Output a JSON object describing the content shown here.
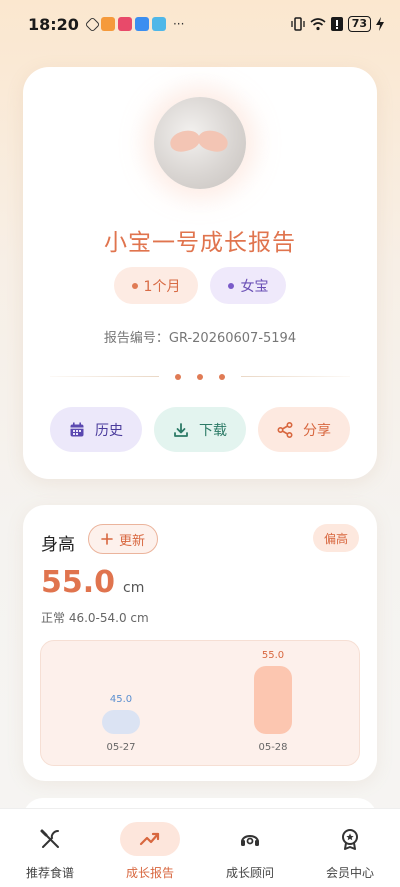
{
  "status_bar": {
    "time": "18:20",
    "more": "···",
    "battery": "73"
  },
  "profile": {
    "title": "小宝一号成长报告",
    "age_tag": "1个月",
    "gender_tag": "女宝",
    "report_id": "报告编号：GR-20260607-5194",
    "actions": {
      "history": "历史",
      "download": "下载",
      "share": "分享"
    }
  },
  "height_card": {
    "title": "身高",
    "update_label": "更新",
    "status": "偏高",
    "value": "55.0",
    "unit": "cm",
    "normal_range": "正常 46.0-54.0 cm",
    "chart_data": {
      "type": "bar",
      "categories": [
        "05-27",
        "05-28"
      ],
      "values": [
        45.0,
        55.0
      ],
      "value_labels": [
        "45.0",
        "55.0"
      ]
    }
  },
  "bottom_nav": {
    "items": [
      {
        "label": "推荐食谱",
        "icon": "utensils-icon"
      },
      {
        "label": "成长报告",
        "icon": "trend-up-icon"
      },
      {
        "label": "成长顾问",
        "icon": "advisor-icon"
      },
      {
        "label": "会员中心",
        "icon": "badge-icon"
      }
    ],
    "active_index": 1
  },
  "colors": {
    "accent": "#e0744e",
    "purple": "#6a4fb5",
    "green": "#2b7a66"
  }
}
